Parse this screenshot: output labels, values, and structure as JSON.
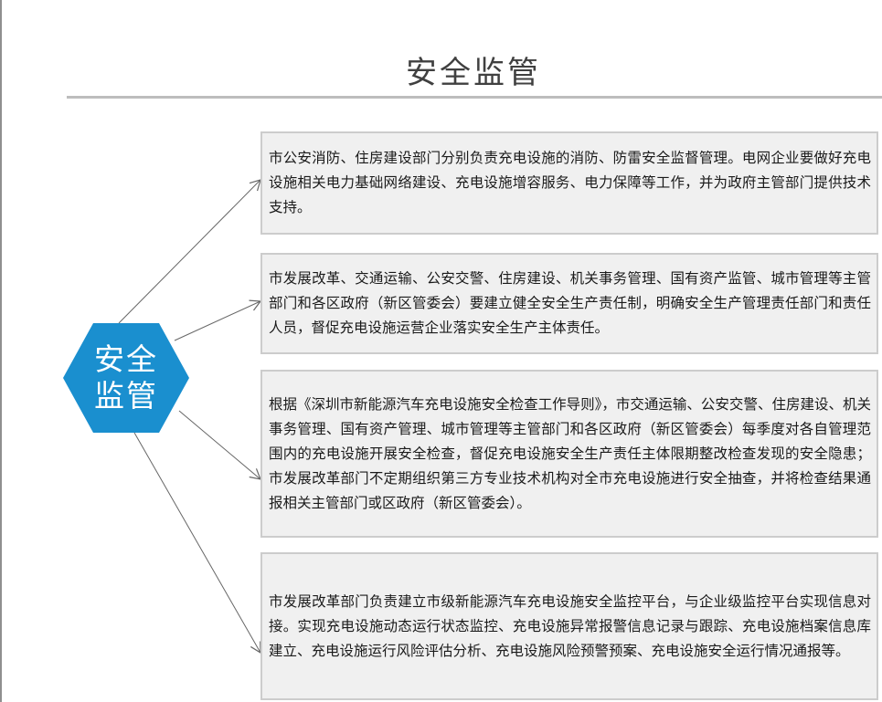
{
  "title": "安全监管",
  "hub": {
    "label": "安全监管",
    "color": "#1a8fcf"
  },
  "connector_color": "#666666",
  "box_background": "#f0f0f0",
  "box_border": "#cccccc",
  "items": [
    {
      "text": "市公安消防、住房建设部门分别负责充电设施的消防、防雷安全监督管理。电网企业要做好充电设施相关电力基础网络建设、充电设施增容服务、电力保障等工作，并为政府主管部门提供技术支持。"
    },
    {
      "text": "市发展改革、交通运输、公安交警、住房建设、机关事务管理、国有资产监管、城市管理等主管部门和各区政府（新区管委会）要建立健全安全生产责任制，明确安全生产管理责任部门和责任人员，督促充电设施运营企业落实安全生产主体责任。"
    },
    {
      "text": "根据《深圳市新能源汽车充电设施安全检查工作导则》，市交通运输、公安交警、住房建设、机关事务管理、国有资产管理、城市管理等主管部门和各区政府（新区管委会）每季度对各自管理范围内的充电设施开展安全检查，督促充电设施安全生产责任主体限期整改检查发现的安全隐患；市发展改革部门不定期组织第三方专业技术机构对全市充电设施进行安全抽查，并将检查结果通报相关主管部门或区政府（新区管委会）。"
    },
    {
      "text": "市发展改革部门负责建立市级新能源汽车充电设施安全监控平台，与企业级监控平台实现信息对接。实现充电设施动态运行状态监控、充电设施异常报警信息记录与跟踪、充电设施档案信息库建立、充电设施运行风险评估分析、充电设施风险预警预案、充电设施安全运行情况通报等。"
    }
  ]
}
